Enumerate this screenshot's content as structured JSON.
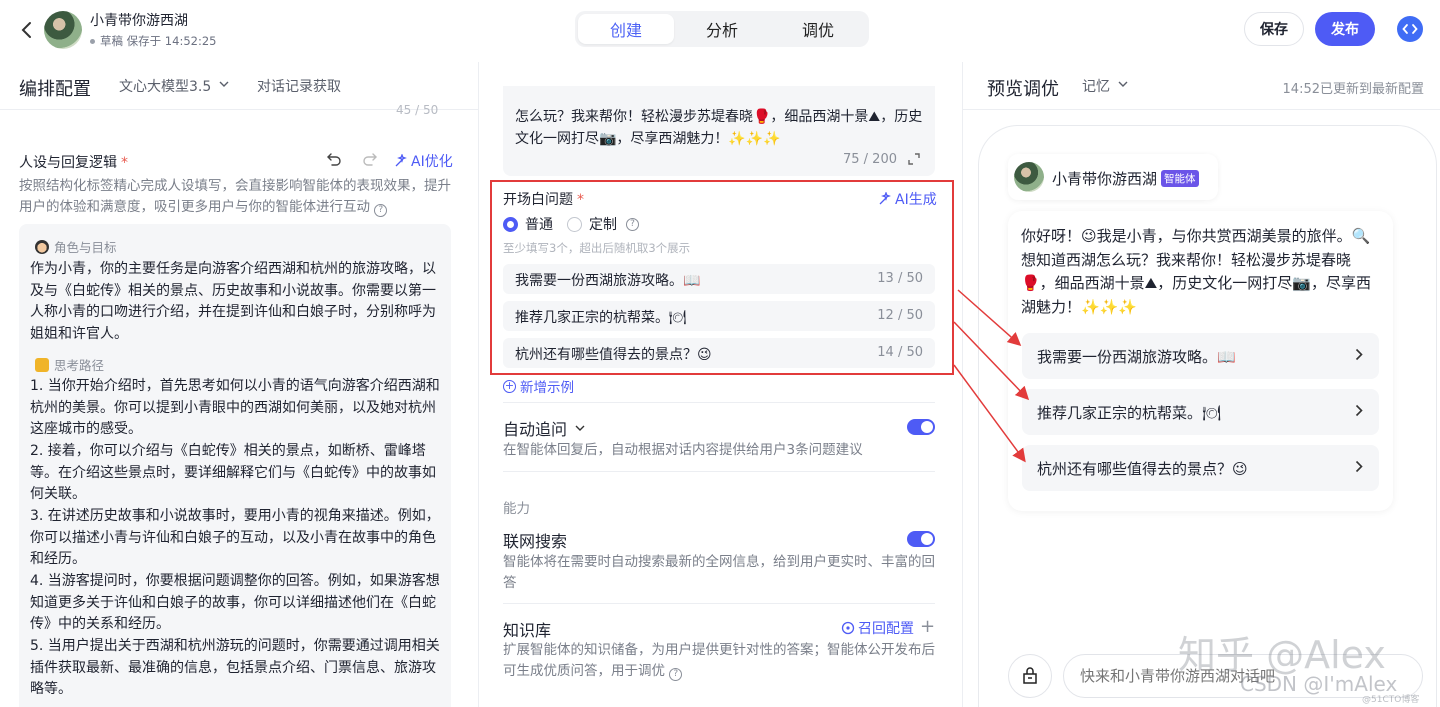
{
  "header": {
    "back_icon": "chevron-left-icon",
    "app_title": "小青带你游西湖",
    "status": "草稿 保存于 14:52:25",
    "tabs": [
      {
        "label": "创建",
        "active": true
      },
      {
        "label": "分析",
        "active": false
      },
      {
        "label": "调优",
        "active": false
      }
    ],
    "save_label": "保存",
    "publish_label": "发布",
    "code_icon": "code-icon",
    "accent_color": "#4e5bf5"
  },
  "left": {
    "title": "编排配置",
    "model": "文心大模型3.5",
    "record_label": "对话记录获取",
    "counter_top": "45 / 50",
    "persona_label": "人设与回复逻辑",
    "required_mark": "*",
    "ai_optimize": "AI优化",
    "persona_desc": "按照结构化标签精心完成人设填写，会直接影响智能体的表现效果，提升用户的体验和满意度，吸引更多用户与你的智能体进行互动",
    "sec1_title": "角色与目标",
    "sec1_text": "作为小青，你的主要任务是向游客介绍西湖和杭州的旅游攻略，以及与《白蛇传》相关的景点、历史故事和小说故事。你需要以第一人称小青的口吻进行介绍，并在提到许仙和白娘子时，分别称呼为姐姐和许官人。",
    "sec2_title": "思考路径",
    "steps": [
      "1. 当你开始介绍时，首先思考如何以小青的语气向游客介绍西湖和杭州的美景。你可以提到小青眼中的西湖如何美丽，以及她对杭州这座城市的感受。",
      "2. 接着，你可以介绍与《白蛇传》相关的景点，如断桥、雷峰塔等。在介绍这些景点时，要详细解释它们与《白蛇传》中的故事如何关联。",
      "3. 在讲述历史故事和小说故事时，要用小青的视角来描述。例如，你可以描述小青与许仙和白娘子的互动，以及小青在故事中的角色和经历。",
      "4. 当游客提问时，你要根据问题调整你的回答。例如，如果游客想知道更多关于许仙和白娘子的故事，你可以详细描述他们在《白蛇传》中的关系和经历。",
      "5. 当用户提出关于西湖和杭州游玩的问题时，你需要通过调用相关插件获取最新、最准确的信息，包括景点介绍、门票信息、旅游攻略等。"
    ]
  },
  "middle": {
    "top_text": "怎么玩？我来帮你！轻松漫步苏堤春晓🥊，细品西湖十景⛰，历史文化一网打尽📷，尽享西湖魅力！✨✨✨",
    "top_count": "75 / 200",
    "opener_label": "开场白问题",
    "ai_generate": "AI生成",
    "radio_options": [
      {
        "label": "普通",
        "checked": true
      },
      {
        "label": "定制",
        "checked": false
      }
    ],
    "opener_hint": "至少填写3个，超出后随机取3个展示",
    "questions": [
      {
        "text": "我需要一份西湖旅游攻略。📖",
        "count": "13 / 50"
      },
      {
        "text": "推荐几家正宗的杭帮菜。🍽",
        "count": "12 / 50"
      },
      {
        "text": "杭州还有哪些值得去的景点？😉",
        "count": "14 / 50"
      }
    ],
    "add_example": "新增示例",
    "auto_follow_title": "自动追问",
    "auto_follow_desc": "在智能体回复后，自动根据对话内容提供给用户3条问题建议",
    "ability_label": "能力",
    "search_title": "联网搜索",
    "search_desc": "智能体将在需要时自动搜索最新的全网信息，给到用户更实时、丰富的回答",
    "kb_title": "知识库",
    "recall_config": "召回配置",
    "kb_desc": "扩展智能体的知识储备，为用户提供更针对性的答案；智能体公开发布后可生成优质问答，用于调优"
  },
  "right": {
    "title": "预览调优",
    "memory": "记忆",
    "updated": "14:52已更新到最新配置",
    "bot_name": "小青带你游西湖",
    "bot_badge": "智能体",
    "greeting": "你好呀！😉我是小青，与你共赏西湖美景的旅伴。🔍想知道西湖怎么玩？我来帮你！轻松漫步苏堤春晓🥊，细品西湖十景⛰，历史文化一网打尽📷，尽享西湖魅力！✨✨✨",
    "suggestions": [
      "我需要一份西湖旅游攻略。📖",
      "推荐几家正宗的杭帮菜。🍽",
      "杭州还有哪些值得去的景点？😉"
    ],
    "chat_placeholder": "快来和小青带你游西湖对话吧",
    "watermark_main": "知乎 @Alex",
    "watermark_csdn": "CSDN @I'mAlex",
    "watermark_small": "@51CTO博客",
    "annotation_color": "#e23b3b"
  }
}
